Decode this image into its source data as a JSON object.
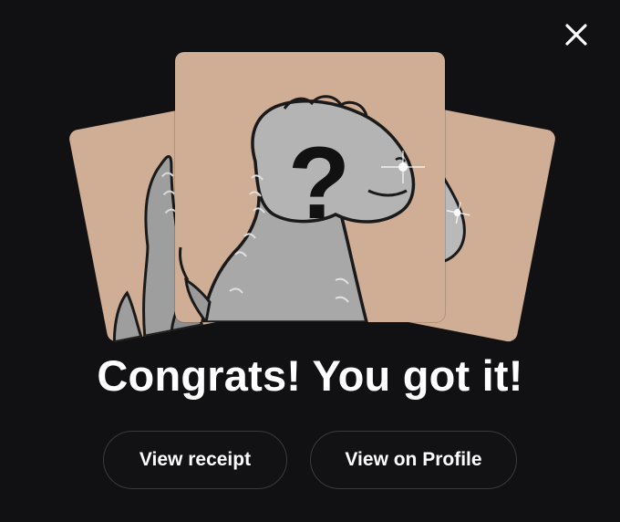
{
  "dialog": {
    "close_icon": "close-icon",
    "headline": "Congrats! You got it!",
    "actions": {
      "view_receipt_label": "View receipt",
      "view_profile_label": "View on Profile"
    },
    "cards": {
      "background_color": "#cfae95",
      "center_image": "mystery-dinosaur-with-question-mark",
      "side_image": "dinosaur-silhouette",
      "mystery_symbol": "?"
    },
    "colors": {
      "background": "#111113",
      "text": "#ffffff",
      "button_border": "#3a3a3e"
    }
  }
}
